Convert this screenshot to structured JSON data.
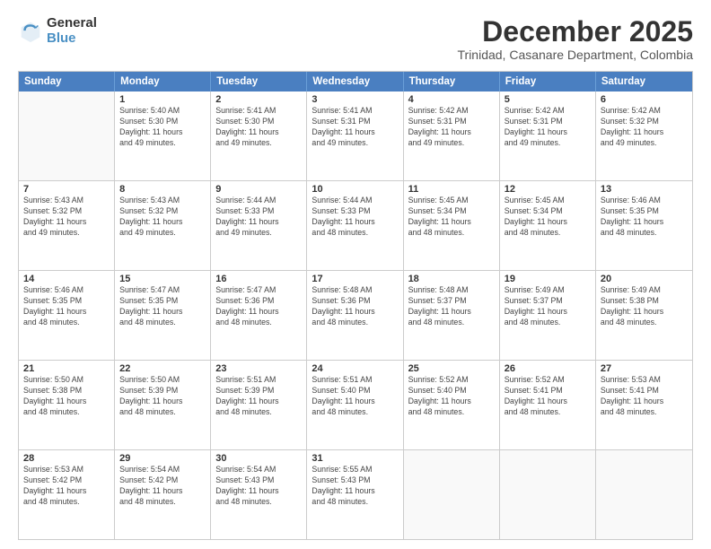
{
  "logo": {
    "general": "General",
    "blue": "Blue"
  },
  "header": {
    "month": "December 2025",
    "location": "Trinidad, Casanare Department, Colombia"
  },
  "days": [
    "Sunday",
    "Monday",
    "Tuesday",
    "Wednesday",
    "Thursday",
    "Friday",
    "Saturday"
  ],
  "weeks": [
    [
      {
        "day": "",
        "data": ""
      },
      {
        "day": "1",
        "data": "Sunrise: 5:40 AM\nSunset: 5:30 PM\nDaylight: 11 hours\nand 49 minutes."
      },
      {
        "day": "2",
        "data": "Sunrise: 5:41 AM\nSunset: 5:30 PM\nDaylight: 11 hours\nand 49 minutes."
      },
      {
        "day": "3",
        "data": "Sunrise: 5:41 AM\nSunset: 5:31 PM\nDaylight: 11 hours\nand 49 minutes."
      },
      {
        "day": "4",
        "data": "Sunrise: 5:42 AM\nSunset: 5:31 PM\nDaylight: 11 hours\nand 49 minutes."
      },
      {
        "day": "5",
        "data": "Sunrise: 5:42 AM\nSunset: 5:31 PM\nDaylight: 11 hours\nand 49 minutes."
      },
      {
        "day": "6",
        "data": "Sunrise: 5:42 AM\nSunset: 5:32 PM\nDaylight: 11 hours\nand 49 minutes."
      }
    ],
    [
      {
        "day": "7",
        "data": "Sunrise: 5:43 AM\nSunset: 5:32 PM\nDaylight: 11 hours\nand 49 minutes."
      },
      {
        "day": "8",
        "data": "Sunrise: 5:43 AM\nSunset: 5:32 PM\nDaylight: 11 hours\nand 49 minutes."
      },
      {
        "day": "9",
        "data": "Sunrise: 5:44 AM\nSunset: 5:33 PM\nDaylight: 11 hours\nand 49 minutes."
      },
      {
        "day": "10",
        "data": "Sunrise: 5:44 AM\nSunset: 5:33 PM\nDaylight: 11 hours\nand 48 minutes."
      },
      {
        "day": "11",
        "data": "Sunrise: 5:45 AM\nSunset: 5:34 PM\nDaylight: 11 hours\nand 48 minutes."
      },
      {
        "day": "12",
        "data": "Sunrise: 5:45 AM\nSunset: 5:34 PM\nDaylight: 11 hours\nand 48 minutes."
      },
      {
        "day": "13",
        "data": "Sunrise: 5:46 AM\nSunset: 5:35 PM\nDaylight: 11 hours\nand 48 minutes."
      }
    ],
    [
      {
        "day": "14",
        "data": "Sunrise: 5:46 AM\nSunset: 5:35 PM\nDaylight: 11 hours\nand 48 minutes."
      },
      {
        "day": "15",
        "data": "Sunrise: 5:47 AM\nSunset: 5:35 PM\nDaylight: 11 hours\nand 48 minutes."
      },
      {
        "day": "16",
        "data": "Sunrise: 5:47 AM\nSunset: 5:36 PM\nDaylight: 11 hours\nand 48 minutes."
      },
      {
        "day": "17",
        "data": "Sunrise: 5:48 AM\nSunset: 5:36 PM\nDaylight: 11 hours\nand 48 minutes."
      },
      {
        "day": "18",
        "data": "Sunrise: 5:48 AM\nSunset: 5:37 PM\nDaylight: 11 hours\nand 48 minutes."
      },
      {
        "day": "19",
        "data": "Sunrise: 5:49 AM\nSunset: 5:37 PM\nDaylight: 11 hours\nand 48 minutes."
      },
      {
        "day": "20",
        "data": "Sunrise: 5:49 AM\nSunset: 5:38 PM\nDaylight: 11 hours\nand 48 minutes."
      }
    ],
    [
      {
        "day": "21",
        "data": "Sunrise: 5:50 AM\nSunset: 5:38 PM\nDaylight: 11 hours\nand 48 minutes."
      },
      {
        "day": "22",
        "data": "Sunrise: 5:50 AM\nSunset: 5:39 PM\nDaylight: 11 hours\nand 48 minutes."
      },
      {
        "day": "23",
        "data": "Sunrise: 5:51 AM\nSunset: 5:39 PM\nDaylight: 11 hours\nand 48 minutes."
      },
      {
        "day": "24",
        "data": "Sunrise: 5:51 AM\nSunset: 5:40 PM\nDaylight: 11 hours\nand 48 minutes."
      },
      {
        "day": "25",
        "data": "Sunrise: 5:52 AM\nSunset: 5:40 PM\nDaylight: 11 hours\nand 48 minutes."
      },
      {
        "day": "26",
        "data": "Sunrise: 5:52 AM\nSunset: 5:41 PM\nDaylight: 11 hours\nand 48 minutes."
      },
      {
        "day": "27",
        "data": "Sunrise: 5:53 AM\nSunset: 5:41 PM\nDaylight: 11 hours\nand 48 minutes."
      }
    ],
    [
      {
        "day": "28",
        "data": "Sunrise: 5:53 AM\nSunset: 5:42 PM\nDaylight: 11 hours\nand 48 minutes."
      },
      {
        "day": "29",
        "data": "Sunrise: 5:54 AM\nSunset: 5:42 PM\nDaylight: 11 hours\nand 48 minutes."
      },
      {
        "day": "30",
        "data": "Sunrise: 5:54 AM\nSunset: 5:43 PM\nDaylight: 11 hours\nand 48 minutes."
      },
      {
        "day": "31",
        "data": "Sunrise: 5:55 AM\nSunset: 5:43 PM\nDaylight: 11 hours\nand 48 minutes."
      },
      {
        "day": "",
        "data": ""
      },
      {
        "day": "",
        "data": ""
      },
      {
        "day": "",
        "data": ""
      }
    ]
  ]
}
